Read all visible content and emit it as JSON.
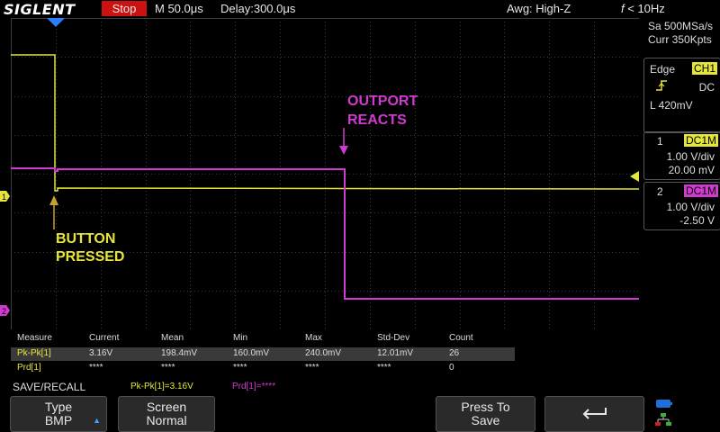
{
  "header": {
    "brand": "SIGLENT",
    "run_state": "Stop",
    "timebase": "M 50.0μs",
    "delay": "Delay:300.0μs",
    "awg": "Awg: High-Z",
    "trigger_freq_symbol": "f",
    "trigger_freq": "< 10Hz"
  },
  "acquisition": {
    "sample_rate": "Sa 500MSa/s",
    "memory": "Curr 350Kpts"
  },
  "trigger": {
    "type": "Edge",
    "source": "CH1",
    "slope_icon": "rising-edge-icon",
    "coupling": "DC",
    "level": "L  420mV"
  },
  "channels": [
    {
      "number": "1",
      "coupling": "DC1M",
      "scale": "1.00 V/div",
      "offset": "20.00 mV",
      "color": "#e6e63a"
    },
    {
      "number": "2",
      "coupling": "DC1M",
      "scale": "1.00 V/div",
      "offset": "-2.50 V",
      "color": "#d03ad0"
    }
  ],
  "annotations": {
    "button_line1": "BUTTON",
    "button_line2": "PRESSED",
    "outport_line1": "OUTPORT",
    "outport_line2": "REACTS"
  },
  "waveform_markers": {
    "ch1": "1",
    "ch2": "2"
  },
  "measurements": {
    "headers": [
      "Measure",
      "Current",
      "Mean",
      "Min",
      "Max",
      "Std-Dev",
      "Count"
    ],
    "rows": [
      [
        "Pk-Pk[1]",
        "3.16V",
        "198.4mV",
        "160.0mV",
        "240.0mV",
        "12.01mV",
        "26"
      ],
      [
        "Prd[1]",
        "****",
        "****",
        "****",
        "****",
        "****",
        "0"
      ]
    ]
  },
  "status": {
    "menu_title": "SAVE/RECALL",
    "pk_readout": "Pk-Pk[1]=3.16V",
    "prd_readout": "Prd[1]=****"
  },
  "softkeys": {
    "type_label": "Type",
    "type_value": "BMP",
    "screen_label": "Screen",
    "screen_value": "Normal",
    "press_label": "Press To",
    "press_value": "Save",
    "back_icon": "return-arrow-icon"
  },
  "colors": {
    "ch1": "#e6e63a",
    "ch2": "#d03ad0",
    "stop": "#cc1111",
    "grid": "#3c3c3c"
  }
}
